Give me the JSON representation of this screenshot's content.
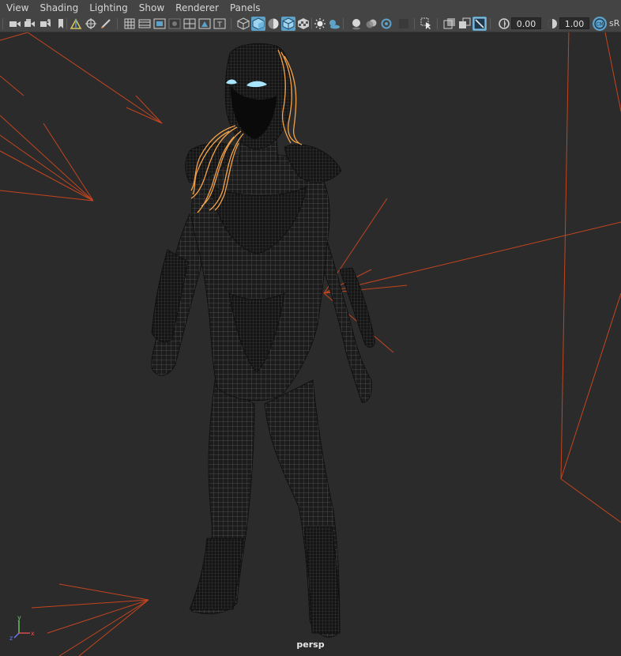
{
  "menubar": {
    "items": [
      "View",
      "Shading",
      "Lighting",
      "Show",
      "Renderer",
      "Panels"
    ]
  },
  "toolbar": {
    "exposure_value": "0.00",
    "gamma_value": "1.00",
    "color_space_label": "sR",
    "icons": [
      "select-camera-icon",
      "camera-attributes-icon",
      "bookmarks-icon",
      "image-plane-icon",
      "2d-pan-zoom-icon",
      "grease-pencil-icon",
      "grid-icon",
      "film-gate-icon",
      "resolution-gate-icon",
      "gate-mask-icon",
      "field-chart-icon",
      "safe-action-icon",
      "safe-title-icon",
      "wireframe-icon",
      "smooth-shade-all-icon",
      "use-default-material-icon",
      "wireframe-on-shaded-icon",
      "textured-icon",
      "use-all-lights-icon",
      "shadows-icon",
      "screen-space-ao-icon",
      "motion-blur-icon",
      "anti-aliasing-icon",
      "depth-of-field-icon",
      "isolate-select-icon",
      "xray-icon",
      "xray-active-components-icon",
      "xray-joints-icon",
      "backface-culling-icon",
      "exposure-icon",
      "gamma-icon",
      "color-management-icon"
    ],
    "active_icons": [
      "smooth-shade-all-icon",
      "wireframe-on-shaded-icon",
      "xray-joints-icon",
      "color-management-icon"
    ]
  },
  "viewport": {
    "camera_name": "persp",
    "axis_labels": {
      "x": "x",
      "y": "y",
      "z": "z"
    }
  },
  "colors": {
    "ui_bg": "#444444",
    "viewport_bg": "#2b2b2b",
    "active_blue": "#5ea1c9",
    "light_lines": "#c4451f",
    "hair": "#f2a24a",
    "eye_highlight": "#a8e6ff",
    "wire": "#555555"
  }
}
